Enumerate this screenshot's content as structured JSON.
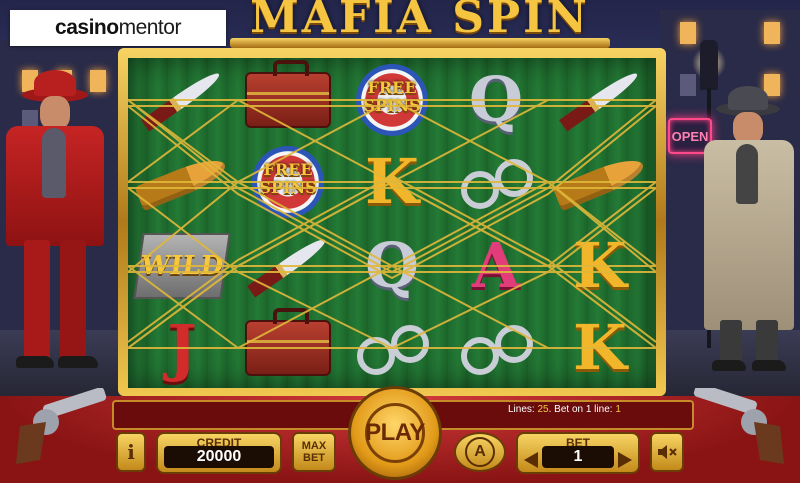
{
  "branding": {
    "logo_part1": "casino",
    "logo_part2": "mentor"
  },
  "game": {
    "title": "MAFIA SPIN"
  },
  "background": {
    "sign": "OPEN"
  },
  "symbols": {
    "free_spins_line1": "FREE",
    "free_spins_line2": "SPINS",
    "wild": "WILD",
    "letters": {
      "A": "A",
      "K": "K",
      "Q": "Q",
      "J": "J"
    }
  },
  "status": {
    "lines_label": "Lines:",
    "lines_value": "25",
    "bet_line_label": "Bet on 1 line:",
    "bet_line_value": "1"
  },
  "controls": {
    "info_label": "i",
    "credit_label": "CREDIT",
    "credit_value": "20000",
    "max_bet_line1": "MAX",
    "max_bet_line2": "BET",
    "play_label": "PLAY",
    "autoplay_label": "A",
    "bet_label": "BET",
    "bet_value": "1",
    "sound_icon": "speaker-mute-icon"
  },
  "colors": {
    "gold": "#f5c542",
    "console_red": "#b82020",
    "reel_green": "#247a36"
  }
}
